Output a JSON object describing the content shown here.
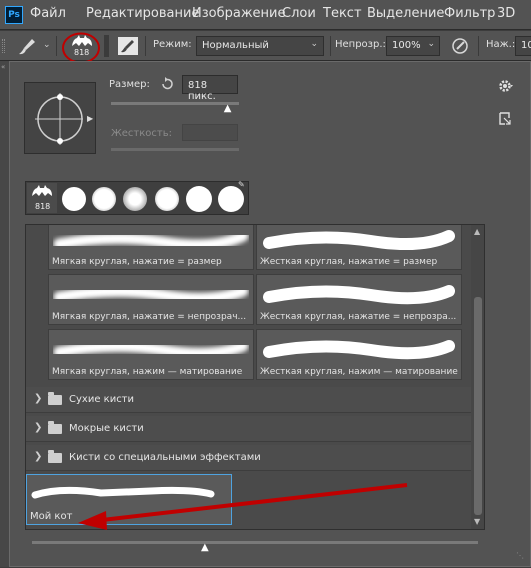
{
  "menubar": {
    "logo": "Ps",
    "items": [
      "Файл",
      "Редактирование",
      "Изображение",
      "Слои",
      "Текст",
      "Выделение",
      "Фильтр",
      "3D"
    ]
  },
  "options": {
    "brush_size_badge": "818",
    "mode_label": "Режим:",
    "mode_value": "Нормальный",
    "opacity_label": "Непрозр.:",
    "opacity_value": "100%",
    "pressure_label": "Наж.:",
    "pressure_value": "100"
  },
  "panel": {
    "size_label": "Размер:",
    "size_value": "818 пикс.",
    "size_slider_fraction": 0.92,
    "hardness_label": "Жесткость:",
    "hardness_value": "",
    "preset_badge": "818",
    "brushes": [
      {
        "label": "Мягкая круглая, нажатие = размер",
        "style": "soft"
      },
      {
        "label": "Жесткая круглая, нажатие = размер",
        "style": "hard"
      },
      {
        "label": "Мягкая круглая, нажатие  = непрозрач...",
        "style": "soft"
      },
      {
        "label": "Жесткая круглая, нажатие  = непрозра...",
        "style": "hard"
      },
      {
        "label": "Мягкая круглая, нажим — матирование",
        "style": "soft"
      },
      {
        "label": "Жесткая круглая, нажим — матирование",
        "style": "hard"
      }
    ],
    "groups": [
      "Сухие кисти",
      "Мокрые кисти",
      "Кисти со специальными эффектами"
    ],
    "custom_brush_label": "Мой кот",
    "bottom_slider_fraction": 0.39
  },
  "colors": {
    "accent_annotation": "#c00000",
    "selection_border": "#4fa3e0"
  }
}
